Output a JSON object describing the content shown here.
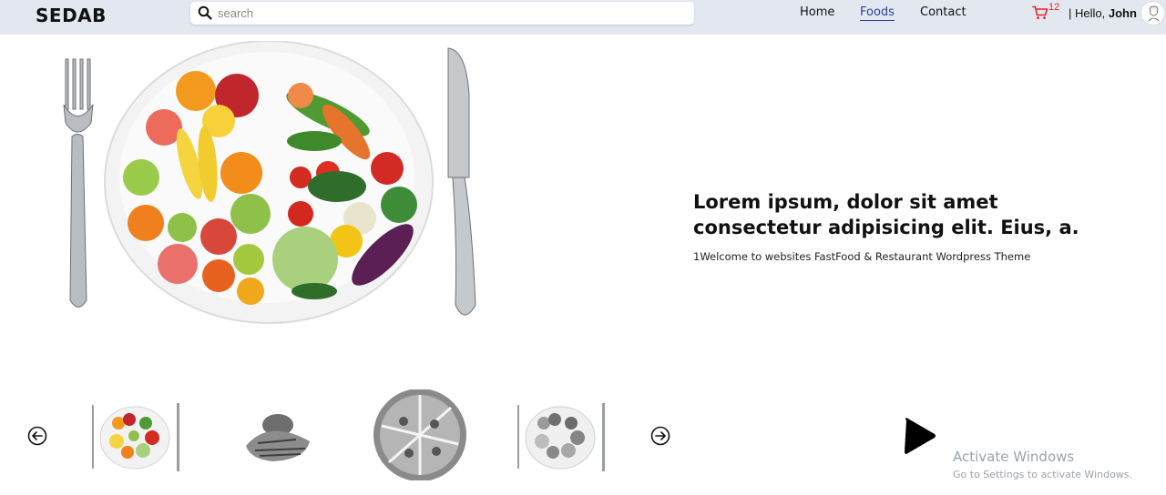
{
  "header": {
    "logo": "SEDAB",
    "search": {
      "placeholder": "search",
      "value": ""
    },
    "nav": [
      {
        "label": "Home",
        "active": false
      },
      {
        "label": "Foods",
        "active": true
      },
      {
        "label": "Contact",
        "active": false
      }
    ],
    "cart": {
      "count": "12",
      "icon": "cart-icon"
    },
    "greeting": "| Hello,",
    "user_name": "John"
  },
  "hero": {
    "title": "Lorem ipsum, dolor sit amet consectetur adipisicing elit. Eius, a.",
    "subtitle": "1Welcome to websites FastFood & Restaurant Wordpress Theme"
  },
  "carousel": {
    "prev_icon": "arrow-left-circle-icon",
    "next_icon": "arrow-right-circle-icon",
    "play_icon": "play-icon",
    "thumbnails": [
      "plate-fork-knife",
      "food-pile-grayscale",
      "pizza-grayscale",
      "plate-grayscale"
    ]
  },
  "watermark": {
    "title": "Activate Windows",
    "subtitle": "Go to Settings to activate Windows."
  },
  "colors": {
    "header_bg": "#e3e8f0",
    "active_nav": "#2c3e9e",
    "cart_red": "#e02424"
  }
}
